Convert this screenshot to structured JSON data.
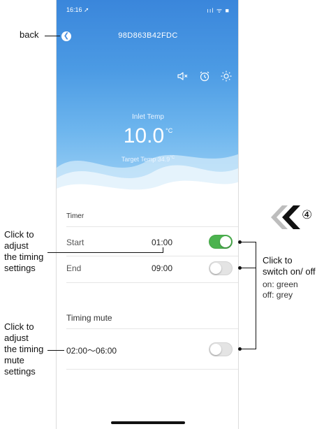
{
  "status_bar": {
    "time": "16:16 ➚",
    "icons": "ııl ᯤ ■"
  },
  "header": {
    "device_id": "98D863B42FDC"
  },
  "controls": {
    "mute_icon": "speaker-muted-icon",
    "timer_icon": "alarm-clock-icon",
    "mode_icon": "sun-icon"
  },
  "reading": {
    "inlet_label": "Inlet Temp",
    "inlet_value": "10.0",
    "inlet_unit": "°C",
    "target_label": "Target Temp",
    "target_value": "34.9",
    "target_unit": "°C"
  },
  "timer": {
    "title": "Timer",
    "start_label": "Start",
    "start_time": "01:00",
    "start_enabled": true,
    "end_label": "End",
    "end_time": "09:00",
    "end_enabled": false
  },
  "timing_mute": {
    "title": "Timing mute",
    "range": "02:00～06:00",
    "enabled": false
  },
  "annotations": {
    "back": "back",
    "adjust_timing": [
      "Click to",
      "adjust",
      "the timing",
      "settings"
    ],
    "adjust_mute": [
      "Click to",
      "adjust",
      "the timing",
      "mute",
      "settings"
    ],
    "switch": [
      "Click to",
      "switch on/ off"
    ],
    "switch_on": "on: green",
    "switch_off": "off: grey",
    "step_number": "④"
  },
  "colors": {
    "toggle_on": "#4cb34f",
    "toggle_off": "#e4e4e4",
    "sky": "#4c9be4"
  }
}
